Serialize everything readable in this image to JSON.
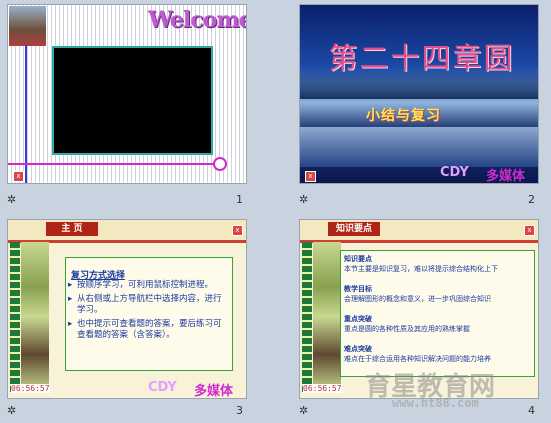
{
  "slides": [
    {
      "number": "1",
      "welcome": "Welcome"
    },
    {
      "number": "2",
      "title": "第二十四章圆",
      "subtitle": "小结与复习",
      "brand_latin": "CDY",
      "brand_cn": "多媒体"
    },
    {
      "number": "3",
      "tab": "主 页",
      "heading": "复习方式选择",
      "bullets": [
        "按顺序学习，可利用鼠标控制进程。",
        "从右侧或上方导航栏中选择内容，进行学习。",
        "也中提示可查看题的答案，要后练习可查看题的答案（含答案）。"
      ],
      "time": "06:56:57",
      "brand_latin": "CDY",
      "brand_cn": "多媒体"
    },
    {
      "number": "4",
      "tab": "知识要点",
      "items": [
        "知识要点",
        "本节主要是知识复习，难以将提示综合结构化上下",
        "教学目标",
        "会理解图形的概念和意义，进一步巩固综合知识",
        "重点突破",
        "重点是圆的各种性质及其应用的熟练掌握",
        "难点突破",
        "难点在于综合运用各种知识解决问题的能力培养"
      ],
      "time": "06:56:57"
    }
  ],
  "watermark": {
    "cn": "育星教育网",
    "url": "www.ht88.com"
  },
  "star_glyph": "✲"
}
